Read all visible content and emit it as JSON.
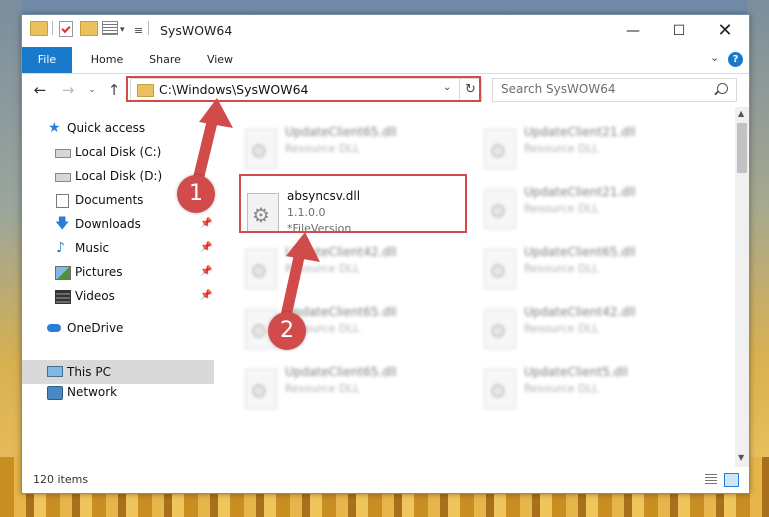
{
  "window": {
    "title": "SysWOW64"
  },
  "title_buttons": {
    "minimize": "—",
    "maximize": "☐",
    "close": "✕"
  },
  "ribbon": {
    "tabs": [
      {
        "label": "File"
      },
      {
        "label": "Home"
      },
      {
        "label": "Share"
      },
      {
        "label": "View"
      }
    ],
    "expand": "⌄",
    "help": "?"
  },
  "navigation": {
    "back": "←",
    "forward": "→",
    "recent": "⌄",
    "up": "↑"
  },
  "address_bar": {
    "path": "C:\\Windows\\SysWOW64",
    "dropdown": "⌄",
    "refresh": "↻"
  },
  "search": {
    "placeholder": "Search SysWOW64"
  },
  "nav_pane": {
    "items": [
      {
        "label": "Quick access",
        "icon": "star-icon"
      },
      {
        "label": "Local Disk (C:)",
        "icon": "drive-icon"
      },
      {
        "label": "Local Disk (D:)",
        "icon": "drive-icon"
      },
      {
        "label": "Documents",
        "icon": "documents-icon",
        "pinned": true
      },
      {
        "label": "Downloads",
        "icon": "download-icon",
        "pinned": true
      },
      {
        "label": "Music",
        "icon": "music-icon",
        "pinned": true
      },
      {
        "label": "Pictures",
        "icon": "pictures-icon",
        "pinned": true
      },
      {
        "label": "Videos",
        "icon": "videos-icon",
        "pinned": true
      },
      {
        "label": "OneDrive",
        "icon": "cloud-icon"
      },
      {
        "label": "This PC",
        "icon": "computer-icon",
        "selected": true
      },
      {
        "label": "Network",
        "icon": "network-icon"
      }
    ],
    "pin_glyph": "📌"
  },
  "files": [
    {
      "name": "UpdateClient65.dll",
      "type": "Resource DLL"
    },
    {
      "name": "UpdateClient21.dll",
      "type": "Resource DLL"
    },
    {
      "name": "absyncsv.dll",
      "version": "1.1.0.0",
      "type": "*FileVersion",
      "highlighted": true
    },
    {
      "name": "UpdateClient21.dll",
      "type": "Resource DLL"
    },
    {
      "name": "UpdateClient42.dll",
      "type": "Resource DLL"
    },
    {
      "name": "UpdateClient65.dll",
      "type": "Resource DLL"
    },
    {
      "name": "UpdateClient65.dll",
      "type": "Resource DLL"
    },
    {
      "name": "UpdateClient42.dll",
      "type": "Resource DLL"
    },
    {
      "name": "UpdateClient65.dll",
      "type": "Resource DLL"
    },
    {
      "name": "UpdateClient5.dll",
      "type": "Resource DLL"
    }
  ],
  "status_bar": {
    "count": "120 items"
  },
  "annotations": {
    "step1": "1",
    "step2": "2",
    "color": "#d24b4b"
  },
  "colors": {
    "accent": "#1979ca",
    "highlight": "#d24b4b",
    "selected_bg": "#d9d9d9"
  }
}
